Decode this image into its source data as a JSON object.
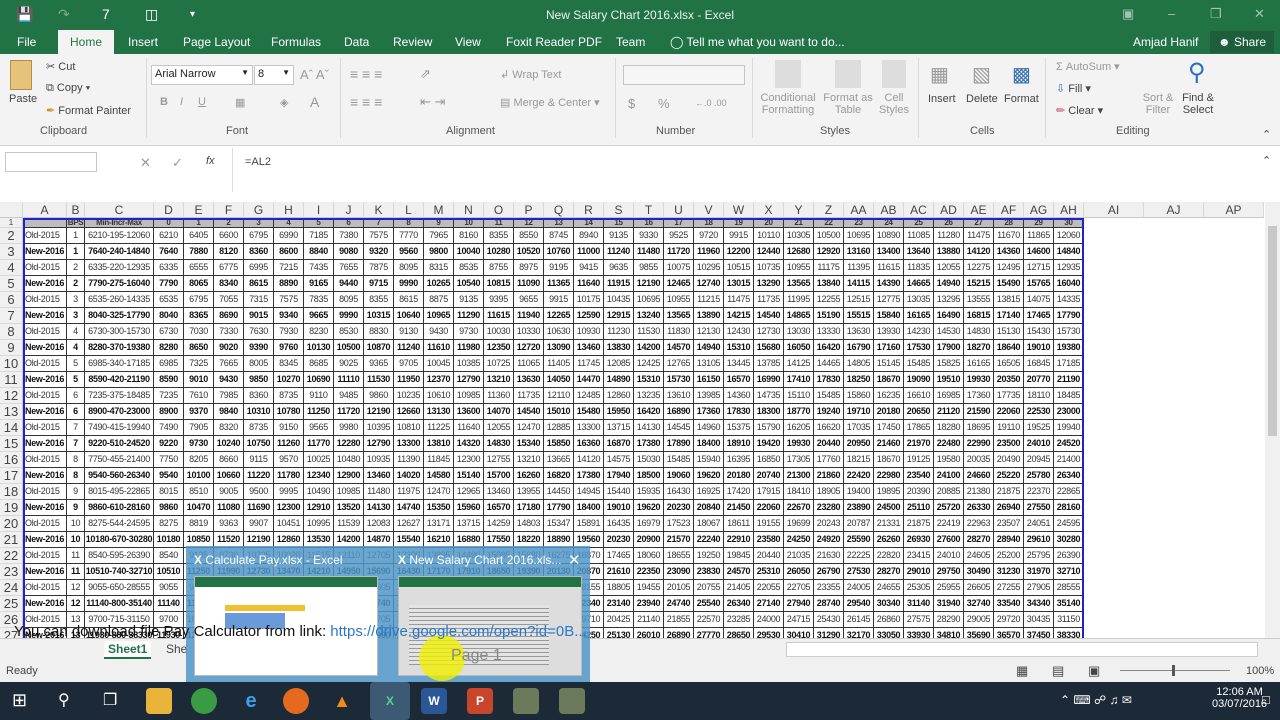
{
  "window": {
    "title": "New Salary Chart 2016.xlsx - Excel",
    "user": "Amjad Hanif",
    "share": "Share"
  },
  "ribbon_tabs": [
    "File",
    "Home",
    "Insert",
    "Page Layout",
    "Formulas",
    "Data",
    "Review",
    "View",
    "Foxit Reader PDF",
    "Team"
  ],
  "tell_me": "Tell me what you want to do...",
  "clipboard": {
    "paste": "Paste",
    "cut": "Cut",
    "copy": "Copy",
    "format_painter": "Format Painter",
    "label": "Clipboard"
  },
  "font": {
    "name": "Arial Narrow",
    "size": "8",
    "bold": "B",
    "italic": "I",
    "underline": "U",
    "label": "Font"
  },
  "alignment": {
    "wrap": "Wrap Text",
    "merge": "Merge & Center",
    "label": "Alignment"
  },
  "number": {
    "format": "",
    "currency": "$",
    "percent": "%",
    "label": "Number"
  },
  "styles": {
    "conditional": "Conditional Formatting",
    "format_table": "Format as Table",
    "cell_styles": "Cell Styles",
    "label": "Styles"
  },
  "cells": {
    "insert": "Insert",
    "delete": "Delete",
    "format": "Format",
    "label": "Cells"
  },
  "editing": {
    "autosum": "AutoSum",
    "fill": "Fill",
    "clear": "Clear",
    "sort": "Sort & Filter",
    "find": "Find & Select",
    "label": "Editing"
  },
  "formula_bar": {
    "name_box": "",
    "formula": "=AL2",
    "fx": "fx"
  },
  "columns": [
    "A",
    "B",
    "C",
    "D",
    "E",
    "F",
    "G",
    "H",
    "I",
    "J",
    "K",
    "L",
    "M",
    "N",
    "O",
    "P",
    "Q",
    "R",
    "S",
    "T",
    "U",
    "V",
    "W",
    "X",
    "Y",
    "Z",
    "AA",
    "AB",
    "AC",
    "AD",
    "AE",
    "AF",
    "AG",
    "AH",
    "AI",
    "AJ",
    "AP"
  ],
  "header_row": {
    "bps": "BPS",
    "scale": "Min-Incr-Max",
    "stages": [
      "0",
      "1",
      "2",
      "3",
      "4",
      "5",
      "6",
      "7",
      "8",
      "9",
      "10",
      "11",
      "12",
      "13",
      "14",
      "15",
      "16",
      "17",
      "18",
      "19",
      "20",
      "21",
      "22",
      "23",
      "24",
      "25",
      "26",
      "27",
      "28",
      "29",
      "30"
    ]
  },
  "rows": [
    {
      "n": "2",
      "label": "Old-2015",
      "bps": "1",
      "scale": "6210-195-12060",
      "bold": false
    },
    {
      "n": "3",
      "label": "New-2016",
      "bps": "1",
      "scale": "7640-240-14840",
      "bold": true
    },
    {
      "n": "4",
      "label": "Old-2015",
      "bps": "2",
      "scale": "6335-220-12935",
      "bold": false
    },
    {
      "n": "5",
      "label": "New-2016",
      "bps": "2",
      "scale": "7790-275-16040",
      "bold": true
    },
    {
      "n": "6",
      "label": "Old-2015",
      "bps": "3",
      "scale": "6535-260-14335",
      "bold": false
    },
    {
      "n": "7",
      "label": "New-2016",
      "bps": "3",
      "scale": "8040-325-17790",
      "bold": true
    },
    {
      "n": "8",
      "label": "Old-2015",
      "bps": "4",
      "scale": "6730-300-15730",
      "bold": false
    },
    {
      "n": "9",
      "label": "New-2016",
      "bps": "4",
      "scale": "8280-370-19380",
      "bold": true
    },
    {
      "n": "10",
      "label": "Old-2015",
      "bps": "5",
      "scale": "6985-340-17185",
      "bold": false
    },
    {
      "n": "11",
      "label": "New-2016",
      "bps": "5",
      "scale": "8590-420-21190",
      "bold": true
    },
    {
      "n": "12",
      "label": "Old-2015",
      "bps": "6",
      "scale": "7235-375-18485",
      "bold": false
    },
    {
      "n": "13",
      "label": "New-2016",
      "bps": "6",
      "scale": "8900-470-23000",
      "bold": true
    },
    {
      "n": "14",
      "label": "Old-2015",
      "bps": "7",
      "scale": "7490-415-19940",
      "bold": false
    },
    {
      "n": "15",
      "label": "New-2016",
      "bps": "7",
      "scale": "9220-510-24520",
      "bold": true
    },
    {
      "n": "16",
      "label": "Old-2015",
      "bps": "8",
      "scale": "7750-455-21400",
      "bold": false
    },
    {
      "n": "17",
      "label": "New-2016",
      "bps": "8",
      "scale": "9540-560-26340",
      "bold": true
    },
    {
      "n": "18",
      "label": "Old-2015",
      "bps": "9",
      "scale": "8015-495-22865",
      "bold": false
    },
    {
      "n": "19",
      "label": "New-2016",
      "bps": "9",
      "scale": "9860-610-28160",
      "bold": true
    },
    {
      "n": "20",
      "label": "Old-2015",
      "bps": "10",
      "scale": "8275-544-24595",
      "bold": false
    },
    {
      "n": "21",
      "label": "New-2016",
      "bps": "10",
      "scale": "10180-670-30280",
      "bold": true
    },
    {
      "n": "22",
      "label": "Old-2015",
      "bps": "11",
      "scale": "8540-595-26390",
      "bold": false
    },
    {
      "n": "23",
      "label": "New-2016",
      "bps": "11",
      "scale": "10510-740-32710",
      "bold": true
    },
    {
      "n": "24",
      "label": "Old-2015",
      "bps": "12",
      "scale": "9055-650-28555",
      "bold": false
    },
    {
      "n": "25",
      "label": "New-2016",
      "bps": "12",
      "scale": "11140-800-35140",
      "bold": true
    },
    {
      "n": "26",
      "label": "Old-2015",
      "bps": "13",
      "scale": "9700-715-31150",
      "bold": false
    },
    {
      "n": "27",
      "label": "New-2016",
      "bps": "13",
      "scale": "11930-880-38330",
      "bold": true
    }
  ],
  "sheets": [
    "Sheet1",
    "She"
  ],
  "status": {
    "ready": "Ready",
    "zoom": "100%"
  },
  "popup": {
    "items": [
      {
        "title": "Calculate Pay.xlsx - Excel"
      },
      {
        "title": "New Salary Chart 2016.xls..."
      }
    ],
    "page_label": "Page 1"
  },
  "caption": {
    "text": "You can download file Pay Calculator from link: ",
    "link": "https://drive.google.com/open?id=0B..."
  },
  "clock": {
    "time": "12:06 AM",
    "date": "03/07/2016"
  },
  "colors": {
    "excel_green": "#217346",
    "header_fill": "#bdbdbd",
    "selection_border": "#2222cc"
  }
}
